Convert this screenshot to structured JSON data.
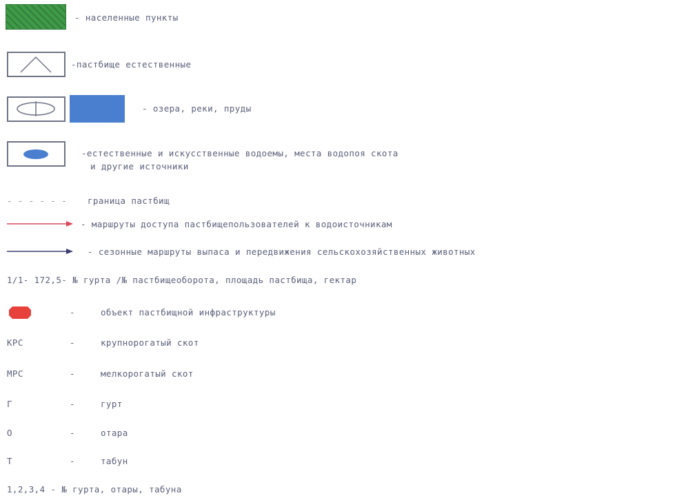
{
  "colors": {
    "settlement": "#3f9a48",
    "water": "#4a7fd0",
    "access_route": "#d94a5a",
    "seasonal_route": "#3a3f6e",
    "infrastructure": "#e8413c",
    "text": "#5a5f7a"
  },
  "legend": {
    "settlements": "- населенные пункты",
    "pasture_natural": "-пастбище естественные",
    "lakes": "- озера, реки, пруды",
    "waterbodies_line1": "-естественные и искусственные водоемы, места водопоя скота",
    "waterbodies_line2": "и другие источники",
    "boundary_dashes": "- - - - - -",
    "boundary": "граница пастбищ",
    "access_routes": "- маршруты доступа пастбищепользователей к водоисточникам",
    "seasonal_routes": "- сезонные маршруты выпаса и передвижения сельскохозяйственных животных",
    "herd_area": "1/1- 172,5- № гурта /№ пастбищеоборота, площадь пастбища, гектар",
    "infra_dash": "-",
    "infrastructure": "объект пастбищной инфраструктуры",
    "abbreviations": [
      {
        "abbr": "КРС",
        "dash": "-",
        "meaning": "крупнорогатый скот"
      },
      {
        "abbr": "МРС",
        "dash": "-",
        "meaning": "мелкорогатый скот"
      },
      {
        "abbr": "Г",
        "dash": "-",
        "meaning": "гурт"
      },
      {
        "abbr": "О",
        "dash": "-",
        "meaning": "отара"
      },
      {
        "abbr": "Т",
        "dash": "-",
        "meaning": "табун"
      }
    ],
    "numbering": "1,2,3,4 - № гурта, отары, табуна"
  }
}
